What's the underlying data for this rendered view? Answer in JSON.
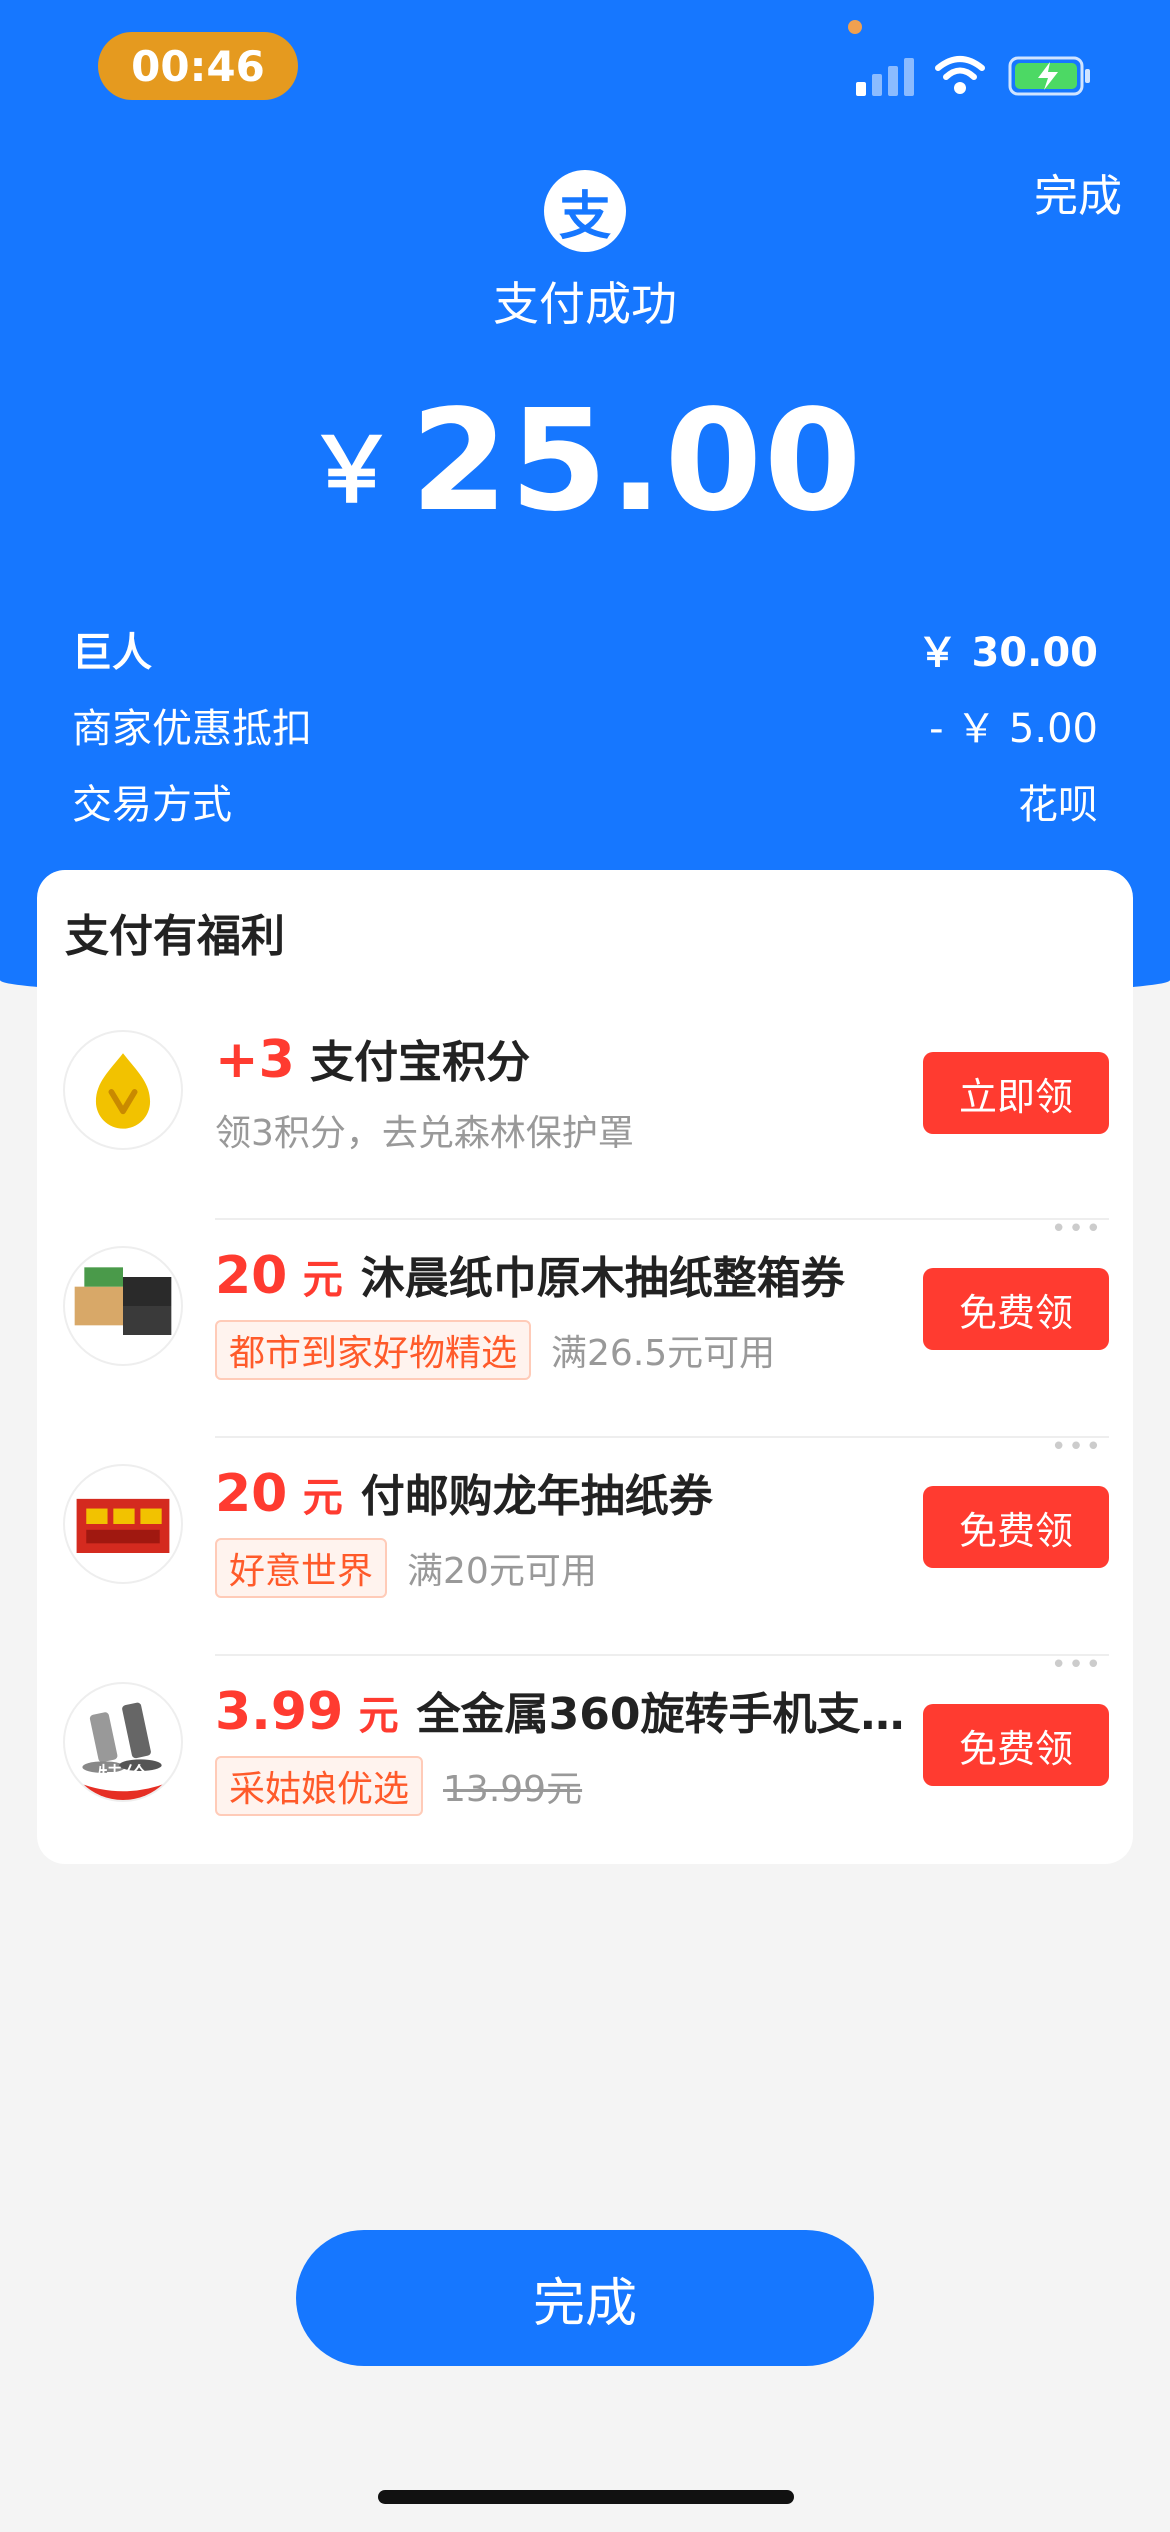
{
  "status_bar": {
    "time": "00:46"
  },
  "header": {
    "done_label": "完成",
    "logo_char": "支",
    "title": "支付成功",
    "currency": "￥",
    "amount": "25.00"
  },
  "details": [
    {
      "label": "巨人",
      "value": "￥ 30.00"
    },
    {
      "label": "商家优惠抵扣",
      "value": "- ￥ 5.00"
    },
    {
      "label": "交易方式",
      "value": "花呗"
    }
  ],
  "benefits": {
    "title": "支付有福利",
    "items": [
      {
        "value": "+3",
        "unit": "",
        "name": "支付宝积分",
        "tag": "",
        "desc": "领3积分，去兑森林保护罩",
        "button": "立即领",
        "icon": "points-icon"
      },
      {
        "value": "20",
        "unit": "元",
        "name": "沐晨纸巾原木抽纸整箱券",
        "tag": "都市到家好物精选",
        "desc": "满26.5元可用",
        "button": "免费领",
        "icon": "tissue-box-image"
      },
      {
        "value": "20",
        "unit": "元",
        "name": "付邮购龙年抽纸券",
        "tag": "好意世界",
        "desc": "满20元可用",
        "button": "免费领",
        "icon": "tissue-pack-image"
      },
      {
        "value": "3.99",
        "unit": "元",
        "name": "全金属360旋转手机支…",
        "tag": "采姑娘优选",
        "desc": "13.99元",
        "badge": "特价",
        "button": "免费领",
        "icon": "phone-stand-image"
      }
    ]
  },
  "footer": {
    "done_label": "完成"
  },
  "colors": {
    "primary": "#1677ff",
    "accent_red": "#ff3b30",
    "time_pill": "#e59a1f"
  }
}
